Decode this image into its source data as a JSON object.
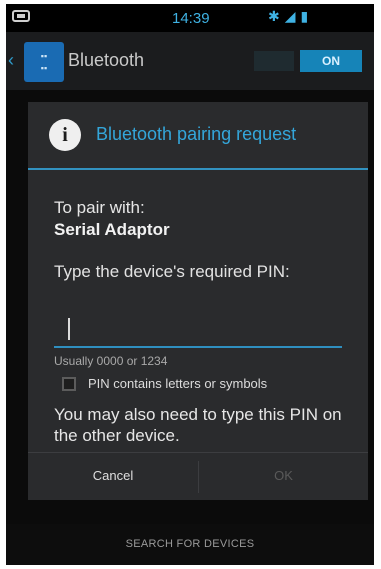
{
  "status_bar": {
    "time": "14:39",
    "icons": [
      "notification-icon",
      "bluetooth-icon",
      "signal-icon",
      "battery-icon"
    ]
  },
  "action_bar": {
    "title": "Bluetooth",
    "toggle_label": "ON"
  },
  "dialog": {
    "title": "Bluetooth pairing request",
    "to_pair_label": "To pair with:",
    "device_name": "Serial Adaptor",
    "pin_prompt": "Type the device's required PIN:",
    "pin_value": "",
    "pin_hint": "Usually 0000 or 1234",
    "checkbox_label": "PIN contains letters or symbols",
    "checkbox_checked": false,
    "note": "You may also need to type this PIN on the other device.",
    "cancel_label": "Cancel",
    "ok_label": "OK"
  },
  "footer": {
    "search_label": "SEARCH FOR DEVICES"
  },
  "colors": {
    "accent": "#34a6da",
    "divider": "#3292c0",
    "dialog_bg": "#2a2b2d"
  }
}
